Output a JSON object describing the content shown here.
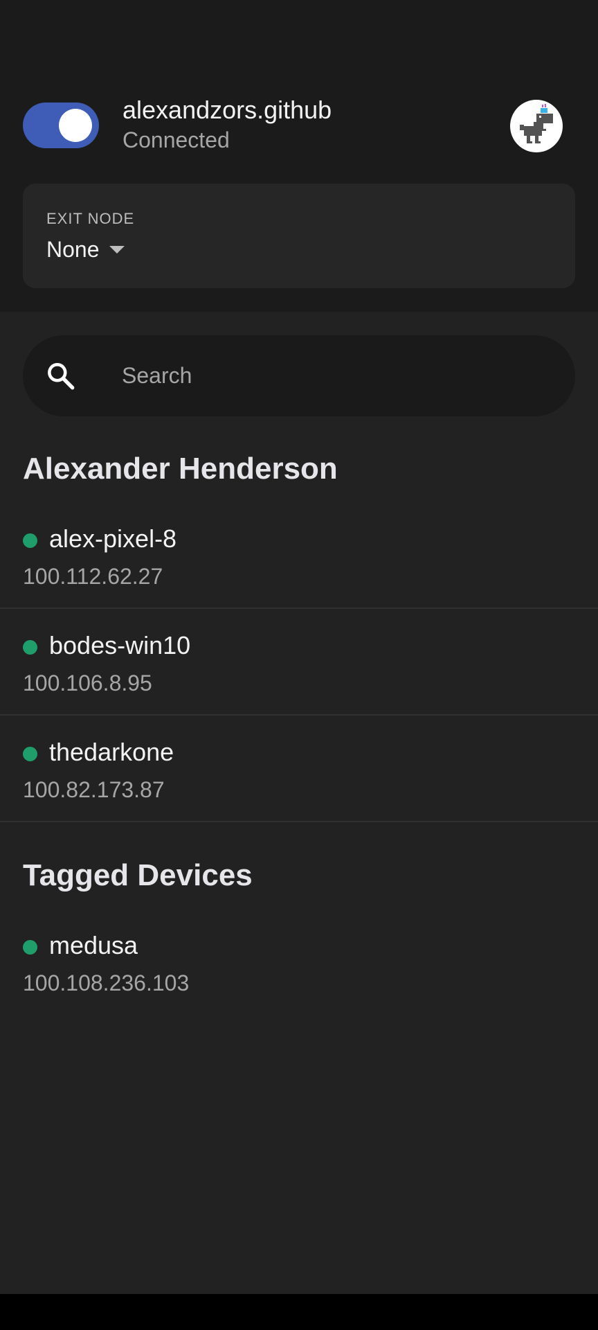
{
  "header": {
    "toggle": {
      "state": "on",
      "accent": "#3f5db7"
    },
    "account_name": "alexandzors.github",
    "status": "Connected",
    "avatar_icon": "dino-avatar-icon"
  },
  "exit_node": {
    "label": "EXIT NODE",
    "value": "None",
    "dropdown_icon": "caret-down-icon"
  },
  "search": {
    "placeholder": "Search",
    "value": "",
    "icon": "search-icon"
  },
  "sections": [
    {
      "title": "Alexander Henderson",
      "devices": [
        {
          "name": "alex-pixel-8",
          "ip": "100.112.62.27",
          "online": true
        },
        {
          "name": "bodes-win10",
          "ip": "100.106.8.95",
          "online": true
        },
        {
          "name": "thedarkone",
          "ip": "100.82.173.87",
          "online": true
        }
      ]
    },
    {
      "title": "Tagged Devices",
      "devices": [
        {
          "name": "medusa",
          "ip": "100.108.236.103",
          "online": true
        }
      ]
    }
  ],
  "colors": {
    "online": "#1f9d6a",
    "background": "#222222",
    "header_background": "#1b1b1b"
  }
}
